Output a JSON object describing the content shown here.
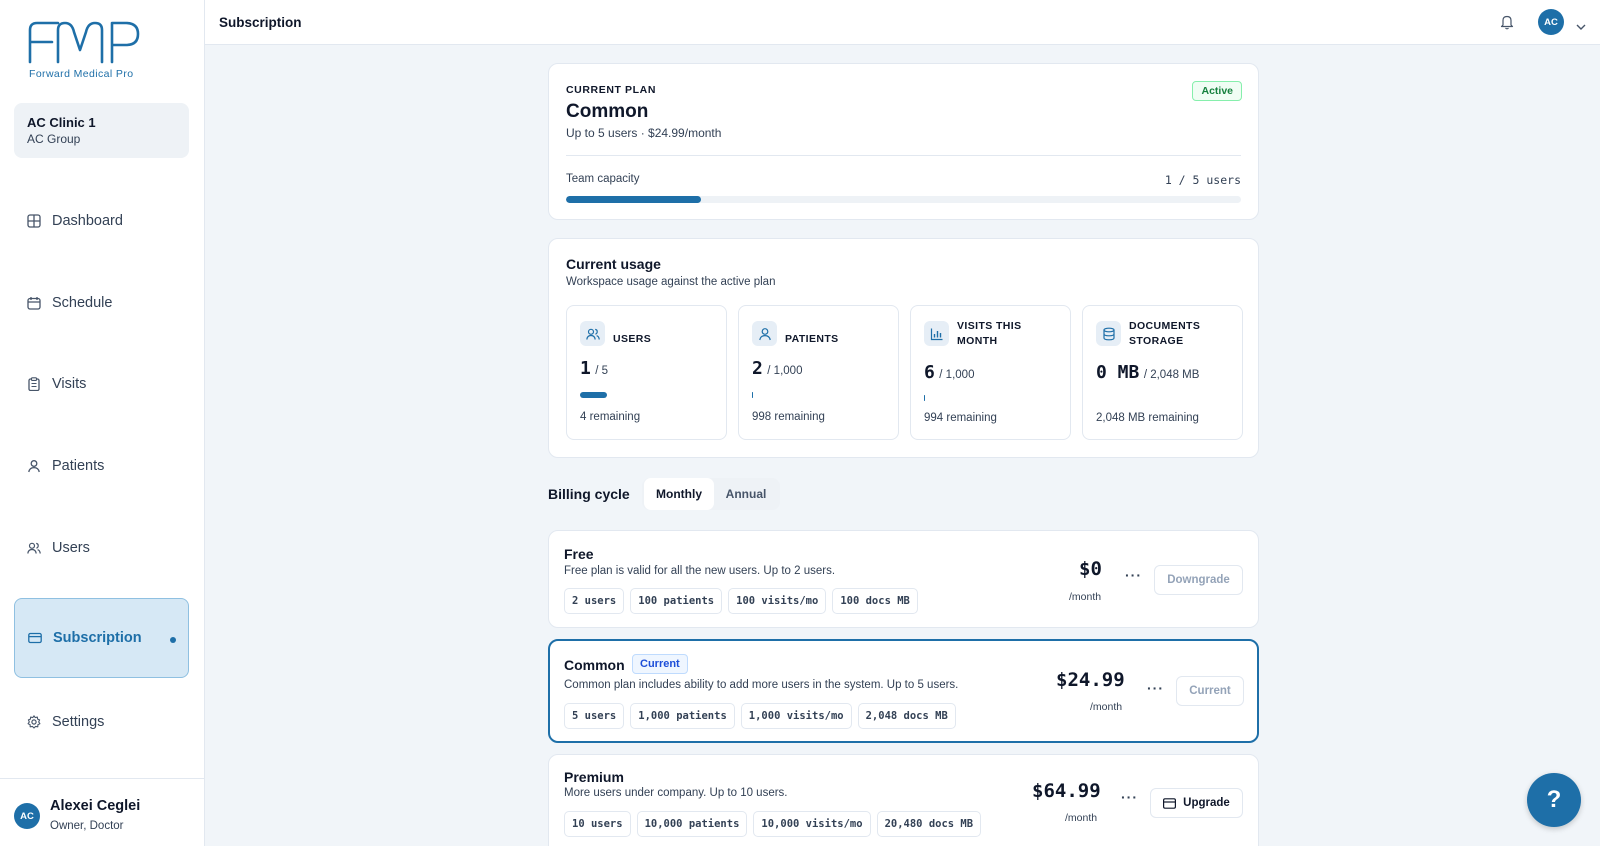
{
  "brand": {
    "name": "Forward Medical Pro",
    "color": "#1e6fa8"
  },
  "org": {
    "name": "AC Clinic 1",
    "group": "AC Group"
  },
  "nav": [
    {
      "label": "Dashboard",
      "icon": "dashboard-icon"
    },
    {
      "label": "Schedule",
      "icon": "calendar-icon"
    },
    {
      "label": "Visits",
      "icon": "clipboard-icon"
    },
    {
      "label": "Patients",
      "icon": "user-icon"
    },
    {
      "label": "Users",
      "icon": "users-icon"
    },
    {
      "label": "Subscription",
      "icon": "credit-card-icon",
      "active": true
    },
    {
      "label": "Settings",
      "icon": "gear-icon"
    }
  ],
  "user": {
    "initials": "AC",
    "name": "Alexei Ceglei",
    "role": "Owner, Doctor"
  },
  "header": {
    "title": "Subscription",
    "avatar_initials": "AC"
  },
  "current_plan": {
    "eyebrow": "CURRENT PLAN",
    "name": "Common",
    "summary": "Up to 5 users · $24.99/month",
    "status": "Active",
    "capacity_label": "Team capacity",
    "capacity_value": "1 / 5 users",
    "capacity_fraction": 0.2
  },
  "usage": {
    "title": "Current usage",
    "subtitle": "Workspace usage against the active plan",
    "stats": [
      {
        "label": "USERS",
        "value": "1",
        "limit": "/ 5",
        "remaining": "4 remaining",
        "fraction": 0.2,
        "icon": "users-icon"
      },
      {
        "label": "PATIENTS",
        "value": "2",
        "limit": "/ 1,000",
        "remaining": "998 remaining",
        "fraction": 0.002,
        "icon": "user-icon"
      },
      {
        "label": "VISITS THIS MONTH",
        "value": "6",
        "limit": "/ 1,000",
        "remaining": "994 remaining",
        "fraction": 0.006,
        "icon": "bar-chart-icon"
      },
      {
        "label": "DOCUMENTS STORAGE",
        "value": "0 MB",
        "limit": "/ 2,048 MB",
        "remaining": "2,048 MB remaining",
        "fraction": 0,
        "icon": "database-icon"
      }
    ]
  },
  "billing": {
    "label": "Billing cycle",
    "options": [
      "Monthly",
      "Annual"
    ],
    "selected": "Monthly"
  },
  "plans": [
    {
      "name": "Free",
      "description": "Free plan is valid for all the new users. Up to 2 users.",
      "chips": [
        "2 users",
        "100 patients",
        "100 visits/mo",
        "100 docs MB"
      ],
      "price": "$0",
      "per": "/month",
      "action": "Downgrade"
    },
    {
      "name": "Common",
      "tag": "Current",
      "description": "Common plan includes ability to add more users in the system. Up to 5 users.",
      "chips": [
        "5 users",
        "1,000 patients",
        "1,000 visits/mo",
        "2,048 docs MB"
      ],
      "price": "$24.99",
      "per": "/month",
      "action": "Current"
    },
    {
      "name": "Premium",
      "description": "More users under company. Up to 10 users.",
      "chips": [
        "10 users",
        "10,000 patients",
        "10,000 visits/mo",
        "20,480 docs MB"
      ],
      "price": "$64.99",
      "per": "/month",
      "action": "Upgrade"
    }
  ],
  "help": {
    "label": "?"
  }
}
